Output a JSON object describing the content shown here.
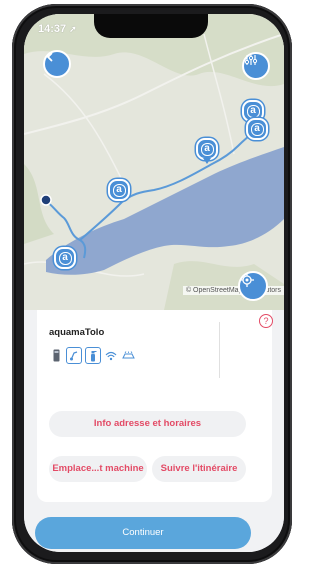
{
  "status_bar": {
    "time": "14:37"
  },
  "map": {
    "attribution": "© OpenStreetMap contributors",
    "marker_glyph": "a",
    "colors": {
      "water": "#8fa7cf",
      "route": "#5b9ad8",
      "marker": "#4a8fd6"
    }
  },
  "sheet": {
    "station_name": "aquamaTolo",
    "help_glyph": "?",
    "buttons": {
      "info": "Info adresse et horaires",
      "location": "Emplace...t machine",
      "route": "Suivre l'itinéraire",
      "continue": "Continuer"
    },
    "accent_color": "#e34b66"
  }
}
